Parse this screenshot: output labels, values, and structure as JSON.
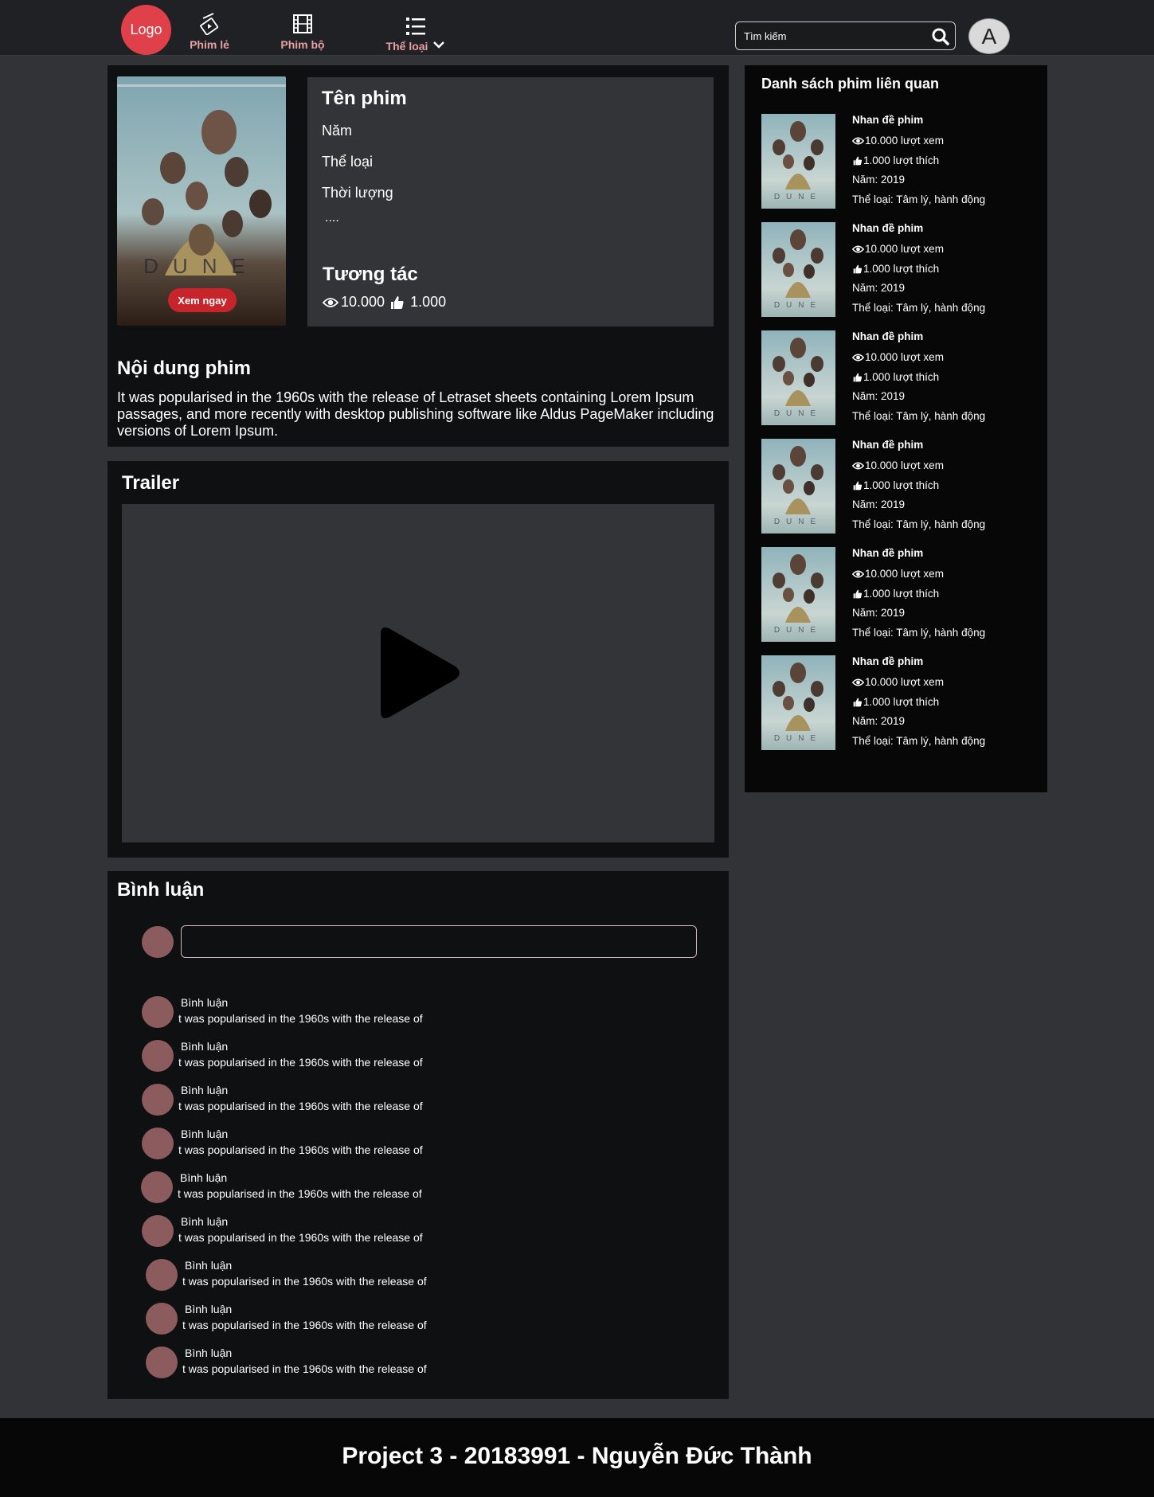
{
  "header": {
    "logo": "Logo",
    "nav": [
      {
        "label": "Phim lẻ",
        "icon": "clapperboard-icon"
      },
      {
        "label": "Phim bộ",
        "icon": "film-icon"
      },
      {
        "label": "Thể  loại",
        "icon": "list-icon"
      }
    ],
    "search_placeholder": "Tìm kiếm",
    "avatar_letter": "A"
  },
  "movie": {
    "title": "Tên phim",
    "year": "Năm",
    "genre": "Thể loại",
    "duration": "Thời lượng",
    "more": "....",
    "watch_label": "Xem ngay",
    "interact_title": "Tương tác",
    "views": "10.000",
    "likes": "1.000"
  },
  "description": {
    "title": "Nội dung phim",
    "text": "It was popularised in the 1960s with the release of Letraset sheets containing Lorem Ipsum passages, and more recently with desktop publishing software like Aldus PageMaker including versions of Lorem Ipsum."
  },
  "trailer": {
    "title": "Trailer"
  },
  "comments": {
    "title": "Bình luận",
    "input_value": "",
    "items": [
      {
        "name": "Bình luận",
        "text": "t was popularised in the 1960s with the release of"
      },
      {
        "name": "Bình luận",
        "text": "t was popularised in the 1960s with the release of"
      },
      {
        "name": "Bình luận",
        "text": "t was popularised in the 1960s with the release of"
      },
      {
        "name": "Bình luận",
        "text": "t was popularised in the 1960s with the release of"
      },
      {
        "name": "Bình luận",
        "text": "t was popularised in the 1960s with the release of"
      },
      {
        "name": "Bình luận",
        "text": "t was popularised in the 1960s with the release of"
      },
      {
        "name": "Bình luận",
        "text": "t was popularised in the 1960s with the release of"
      },
      {
        "name": "Bình luận",
        "text": "t was popularised in the 1960s with the release of"
      },
      {
        "name": "Bình luận",
        "text": "t was popularised in the 1960s with the release of"
      }
    ]
  },
  "related": {
    "title": "Danh sách phim liên quan",
    "items": [
      {
        "title": "Nhan đề phim",
        "views": "10.000 lượt xem",
        "likes": "1.000 lượt thích",
        "year": "Năm: 2019",
        "genre": "Thể loại: Tâm lý, hành động"
      },
      {
        "title": "Nhan đề phim",
        "views": "10.000 lượt xem",
        "likes": "1.000 lượt thích",
        "year": "Năm: 2019",
        "genre": "Thể loại: Tâm lý, hành động"
      },
      {
        "title": "Nhan đề phim",
        "views": "10.000 lượt xem",
        "likes": "1.000 lượt thích",
        "year": "Năm: 2019",
        "genre": "Thể loại: Tâm lý, hành động"
      },
      {
        "title": "Nhan đề phim",
        "views": "10.000 lượt xem",
        "likes": "1.000 lượt thích",
        "year": "Năm: 2019",
        "genre": "Thể loại: Tâm lý, hành động"
      },
      {
        "title": "Nhan đề phim",
        "views": "10.000 lượt xem",
        "likes": "1.000 lượt thích",
        "year": "Năm: 2019",
        "genre": "Thể loại: Tâm lý, hành động"
      },
      {
        "title": "Nhan đề phim",
        "views": "10.000 lượt xem",
        "likes": "1.000 lượt thích",
        "year": "Năm: 2019",
        "genre": "Thể loại: Tâm lý, hành động"
      }
    ]
  },
  "footer": {
    "text": "Project 3 - 20183991 -  Nguyễn Đức Thành"
  },
  "colors": {
    "accent": "#e0404a",
    "nav_text": "#e7a0a3",
    "panel": "#0f1012",
    "background": "#323336"
  }
}
